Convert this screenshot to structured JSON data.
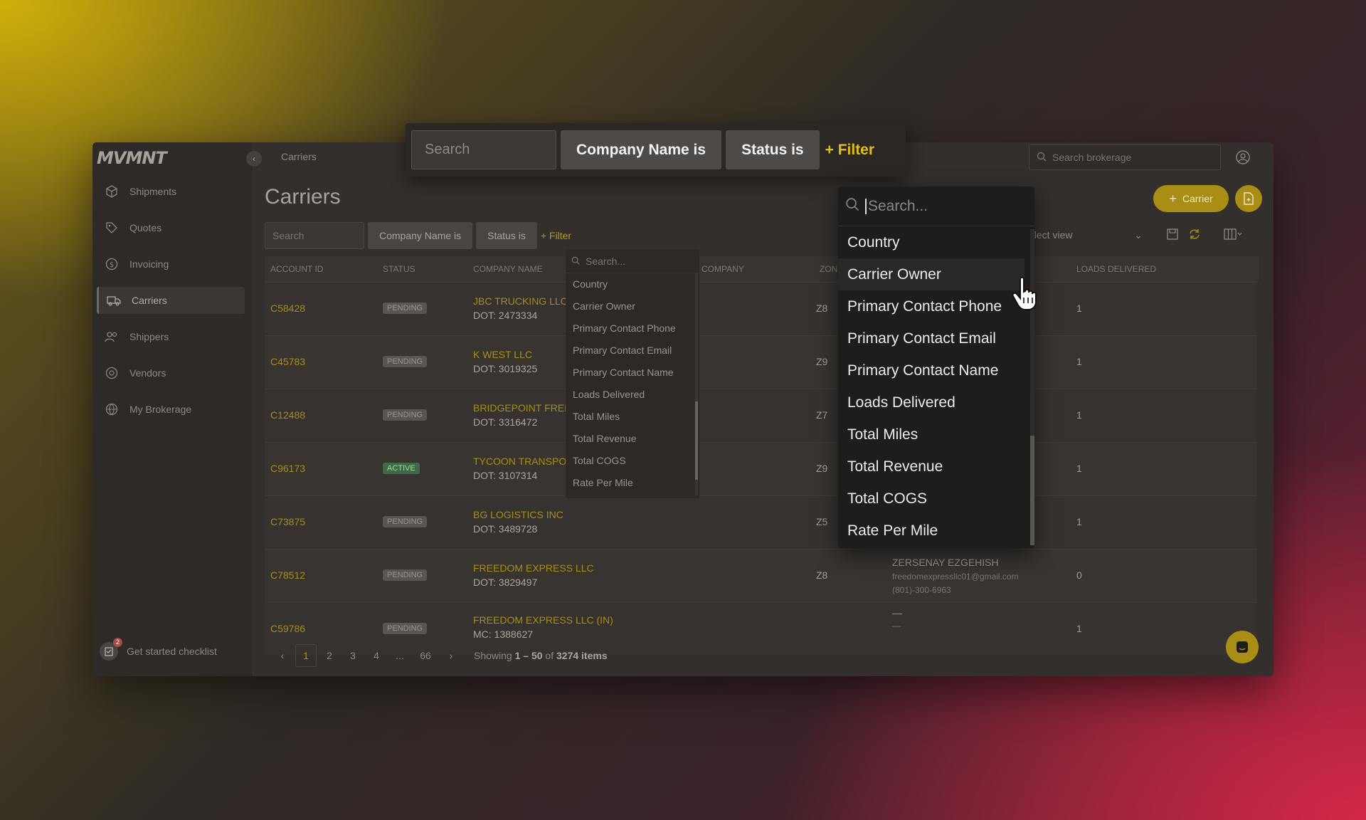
{
  "app": {
    "logo": "MVMNT",
    "breadcrumb": "Carriers",
    "top_search_placeholder": "Search brokerage",
    "page_title": "Carriers",
    "sidebar": {
      "items": [
        {
          "label": "Shipments",
          "icon": "box-icon"
        },
        {
          "label": "Quotes",
          "icon": "tag-icon"
        },
        {
          "label": "Invoicing",
          "icon": "dollar-icon"
        },
        {
          "label": "Carriers",
          "icon": "truck-icon",
          "active": true
        },
        {
          "label": "Shippers",
          "icon": "users-icon"
        },
        {
          "label": "Vendors",
          "icon": "vendor-icon"
        },
        {
          "label": "My Brokerage",
          "icon": "globe-icon"
        }
      ],
      "checklist_label": "Get started checklist",
      "checklist_badge": "2"
    },
    "filters": {
      "search_placeholder": "Search",
      "chip_company": "Company Name is",
      "chip_status": "Status is",
      "add_filter": "+ Filter"
    },
    "toolbar": {
      "carrier_button": "Carrier",
      "select_view": "elect view"
    },
    "table": {
      "headers": {
        "account_id": "ACCOUNT ID",
        "status": "STATUS",
        "company_name": "COMPANY NAME",
        "company": "COMPANY",
        "zone": "ZON",
        "loads_delivered": "LOADS DELIVERED"
      },
      "rows": [
        {
          "account_id": "C58428",
          "status": "PENDING",
          "company": "JBC TRUCKING LLC",
          "dot": "DOT: 2473334",
          "zone": "Z8",
          "loads": "1"
        },
        {
          "account_id": "C45783",
          "status": "PENDING",
          "company": "K WEST LLC",
          "dot": "DOT: 3019325",
          "zone": "Z9",
          "loads": "1"
        },
        {
          "account_id": "C12488",
          "status": "PENDING",
          "company": "BRIDGEPOINT FREI",
          "dot": "DOT: 3316472",
          "zone": "Z7",
          "loads": "1"
        },
        {
          "account_id": "C96173",
          "status": "ACTIVE",
          "company": "TYCOON TRANSPO",
          "dot": "DOT: 3107314",
          "zone": "Z9",
          "loads": "1"
        },
        {
          "account_id": "C73875",
          "status": "PENDING",
          "company": "BG LOGISTICS INC",
          "dot": "DOT: 3489728",
          "zone": "Z5",
          "loads": "1"
        },
        {
          "account_id": "C78512",
          "status": "PENDING",
          "company": "FREEDOM EXPRESS LLC",
          "dot": "DOT: 3829497",
          "zone": "Z8",
          "loads": "0",
          "contact_name": "ZERSENAY EZGEHISH",
          "contact_email": "freedomexpressllc01@gmail.com",
          "contact_phone": "(801)-300-6963"
        },
        {
          "account_id": "C59786",
          "status": "PENDING",
          "company": "FREEDOM EXPRESS LLC (IN)",
          "dot": "MC: 1388627",
          "zone": "",
          "loads": "1",
          "contact_name": "—",
          "contact_email": "—"
        }
      ]
    },
    "pagination": {
      "pages": [
        "1",
        "2",
        "3",
        "4",
        "...",
        "66"
      ],
      "prev": "‹",
      "next": "›",
      "showing_prefix": "Showing ",
      "showing_range": "1 – 50",
      "showing_mid": " of ",
      "showing_total": "3274 items"
    },
    "small_dropdown": {
      "search_placeholder": "Search...",
      "items": [
        "Country",
        "Carrier Owner",
        "Primary Contact Phone",
        "Primary Contact Email",
        "Primary Contact Name",
        "Loads Delivered",
        "Total Miles",
        "Total Revenue",
        "Total COGS",
        "Rate Per Mile"
      ]
    }
  },
  "zoom_overlay": {
    "search_placeholder": "Search",
    "chip_company": "Company Name is",
    "chip_status": "Status is",
    "add_filter": "+ Filter",
    "dropdown_search_placeholder": "Search...",
    "dropdown_items": [
      "Country",
      "Carrier Owner",
      "Primary Contact Phone",
      "Primary Contact Email",
      "Primary Contact Name",
      "Loads Delivered",
      "Total Miles",
      "Total Revenue",
      "Total COGS",
      "Rate Per Mile"
    ],
    "hovered_item": "Carrier Owner"
  },
  "colors": {
    "accent": "#a88e14",
    "accent_bright": "#e0c018",
    "active_status": "#3e6b45"
  }
}
